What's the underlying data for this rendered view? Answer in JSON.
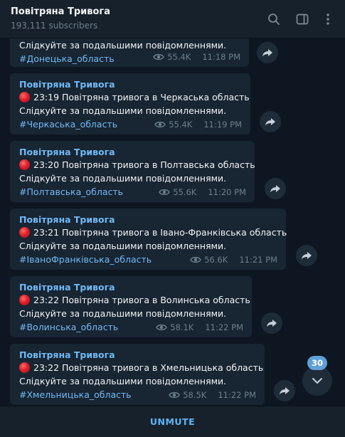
{
  "header": {
    "title": "Повітряна Тривога",
    "subscribers": "193,111 subscribers"
  },
  "colors": {
    "background": "#0e1621",
    "header": "#17212b",
    "bubble": "#182533",
    "accent": "#71baf5",
    "meta": "#6d7f8f",
    "badge": "#5fa0d6"
  },
  "icons": {
    "search": "search-icon",
    "sidebar": "sidebar-toggle-icon",
    "more": "more-vertical-icon",
    "share": "share-arrow-icon",
    "views": "eye-icon",
    "alert": "red-circle-icon",
    "scroll": "chevron-down-icon"
  },
  "messages": [
    {
      "line2": "Слідкуйте за подальшими повідомленнями.",
      "hashtag": "#Донецька_область",
      "views": "55.4K",
      "time": "11:18 PM"
    },
    {
      "author": "Повітряна Тривога",
      "line1": "23:19 Повітряна тривога в Черкаська область",
      "line2": "Слідкуйте за подальшими повідомленнями.",
      "hashtag": "#Черкаська_область",
      "views": "55.4K",
      "time": "11:19 PM"
    },
    {
      "author": "Повітряна Тривога",
      "line1": "23:20 Повітряна тривога в Полтавська область",
      "line2": "Слідкуйте за подальшими повідомленнями.",
      "hashtag": "#Полтавська_область",
      "views": "55.6K",
      "time": "11:20 PM"
    },
    {
      "author": "Повітряна Тривога",
      "line1": "23:21 Повітряна тривога в Івано-Франківська область",
      "line2": "Слідкуйте за подальшими повідомленнями.",
      "hashtag": "#ІваноФранківська_область",
      "views": "56.6K",
      "time": "11:21 PM"
    },
    {
      "author": "Повітряна Тривога",
      "line1": "23:22 Повітряна тривога в Волинська область",
      "line2": "Слідкуйте за подальшими повідомленнями.",
      "hashtag": "#Волинська_область",
      "views": "58.1K",
      "time": "11:22 PM"
    },
    {
      "author": "Повітряна Тривога",
      "line1": "23:22 Повітряна тривога в Хмельницька область",
      "line2": "Слідкуйте за подальшими повідомленнями.",
      "hashtag": "#Хмельницька_область",
      "views": "58.5K",
      "time": "11:22 PM"
    }
  ],
  "scroll": {
    "unread_count": "30"
  },
  "bottom": {
    "unmute_label": "UNMUTE"
  }
}
